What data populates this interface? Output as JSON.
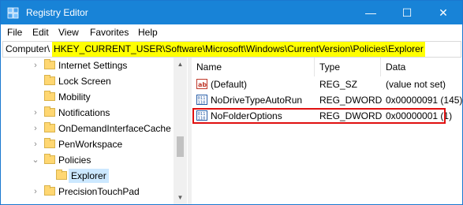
{
  "window": {
    "title": "Registry Editor",
    "icon": "registry-editor-icon",
    "controls": {
      "minimize": "—",
      "maximize": "☐",
      "close": "✕"
    }
  },
  "menu": [
    "File",
    "Edit",
    "View",
    "Favorites",
    "Help"
  ],
  "address": {
    "prefix": "Computer\\",
    "path": "HKEY_CURRENT_USER\\Software\\Microsoft\\Windows\\CurrentVersion\\Policies\\Explorer",
    "highlight_color": "#ffff00"
  },
  "tree": {
    "items": [
      {
        "label": "Internet Settings",
        "expander": "collapsed"
      },
      {
        "label": "Lock Screen",
        "expander": "none"
      },
      {
        "label": "Mobility",
        "expander": "none"
      },
      {
        "label": "Notifications",
        "expander": "collapsed"
      },
      {
        "label": "OnDemandInterfaceCache",
        "expander": "collapsed"
      },
      {
        "label": "PenWorkspace",
        "expander": "collapsed"
      },
      {
        "label": "Policies",
        "expander": "expanded"
      },
      {
        "label": "Explorer",
        "expander": "none",
        "selected": true
      },
      {
        "label": "PrecisionTouchPad",
        "expander": "collapsed"
      }
    ]
  },
  "list": {
    "columns": [
      "Name",
      "Type",
      "Data"
    ],
    "rows": [
      {
        "icon": "string-value-icon",
        "name": "(Default)",
        "type": "REG_SZ",
        "data": "(value not set)"
      },
      {
        "icon": "dword-value-icon",
        "name": "NoDriveTypeAutoRun",
        "type": "REG_DWORD",
        "data": "0x00000091 (145)"
      },
      {
        "icon": "dword-value-icon",
        "name": "NoFolderOptions",
        "type": "REG_DWORD",
        "data": "0x00000001 (1)",
        "highlighted": true
      }
    ],
    "highlight_color": "#e01010"
  },
  "colors": {
    "titlebar": "#1883d7",
    "selection": "#cce8ff",
    "folder": "#ffd772"
  }
}
